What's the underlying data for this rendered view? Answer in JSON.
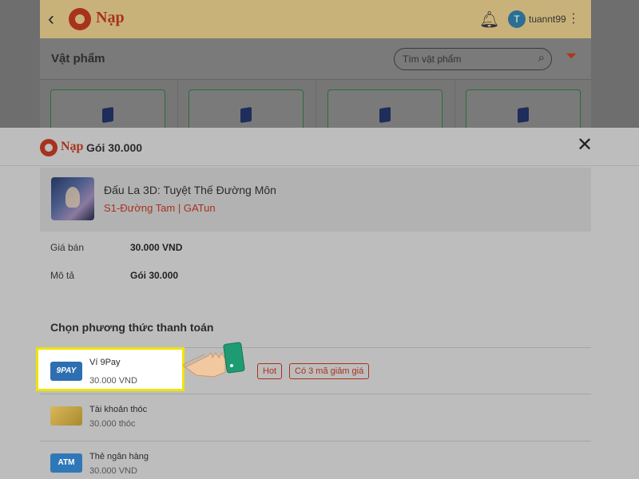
{
  "bg": {
    "back_icon": "chevron-left-icon",
    "brand": "Nạp",
    "username": "tuannt99",
    "avatar_letter": "T",
    "section_title": "Vật phẩm",
    "search_placeholder": "Tìm vật phẩm"
  },
  "sheet": {
    "brand": "Nạp",
    "title": "Gói 30.000",
    "close_icon": "close-icon"
  },
  "game": {
    "name": "Đấu La 3D: Tuyệt Thế Đường Môn",
    "server": "S1-Đường Tam | GATun"
  },
  "details": {
    "price_label": "Giá bán",
    "price_value": "30.000 VND",
    "desc_label": "Mô tả",
    "desc_value": "Gói 30.000"
  },
  "payment": {
    "title": "Chọn phương thức thanh toán",
    "methods": [
      {
        "name": "Ví 9Pay",
        "price": "30.000 VND",
        "icon_text": "9PAY"
      },
      {
        "name": "Tài khoản thóc",
        "price": "30.000 thóc"
      },
      {
        "name": "Thẻ ngân hàng",
        "price": "30.000 VND",
        "icon_text": "ATM"
      }
    ],
    "badges": [
      "Hot",
      "Có 3 mã giảm giá"
    ]
  },
  "colors": {
    "accent": "#a8321d",
    "highlight": "#f0e400",
    "wallet_blue": "#2e6fb2"
  }
}
